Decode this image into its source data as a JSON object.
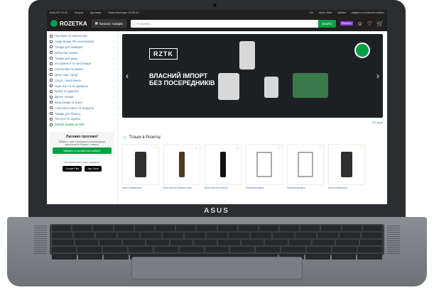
{
  "topbar": {
    "phone": "(044) 537-02-22",
    "links": [
      "Бонусы",
      "Доставка",
      "Наши переходы COVID-19"
    ],
    "lang": "RU",
    "city": "Місто: Київ",
    "my_account": "Кабінет",
    "login_link": "увійдіть в особистий кабінет"
  },
  "header": {
    "logo": "ROZETKA",
    "catalog_label": "Каталог товарів",
    "search_placeholder": "Я шукаю...",
    "search_button": "Знайти",
    "premium_label": "Premium"
  },
  "sidebar": {
    "categories": [
      "Ноутбуки та комп'ютери",
      "Смартфони, ТВ і електроніка",
      "Товари для геймерів",
      "Побутова техніка",
      "Товари для дому",
      "Інструменти та автотовари",
      "Сантехніка та ремонт",
      "Дача, сад і город",
      "Спорт і захоплення",
      "Одяг, взуття та прикраси",
      "Краса та здоров'я",
      "Дитячі товари",
      "Канцтовари та книги",
      "Алкогольні напої та продукти",
      "Товари для бізнесу",
      "Послуги та сервіси"
    ],
    "discount_label": "Зимові знижки до 50%",
    "login_box": {
      "title": "Ласкаво просимо!",
      "subtitle": "Увійдіть, щоб отримувати рекомендації, персональні бонуси і знижки.",
      "button": "Увійдіть в особистий кабінет"
    },
    "apps_title": "Встановлюйте наші додатки",
    "apps": [
      "Google Play",
      "App Store"
    ]
  },
  "banner": {
    "brand": "RZTK",
    "line1": "ВЛАСНИЙ ІМПОРТ",
    "line2": "БЕЗ ПОСЕРЕДНИКІВ",
    "badge": "Власна марка"
  },
  "all_actions": "Всі акції",
  "section": {
    "title": "Тільки в Розетці"
  },
  "products": [
    {
      "name": "Крісло геймерське",
      "kind": "chair"
    },
    {
      "name": "Вино ігристе Каберне Брют",
      "kind": "bottle"
    },
    {
      "name": "Вино ігристе Prosecco",
      "kind": "bottle"
    },
    {
      "name": "Рушникосушарка",
      "kind": "rail"
    },
    {
      "name": "Рушникосушарка",
      "kind": "rail"
    },
    {
      "name": "Крісло геймерське",
      "kind": "chair"
    }
  ],
  "laptop_brand": "ASUS"
}
